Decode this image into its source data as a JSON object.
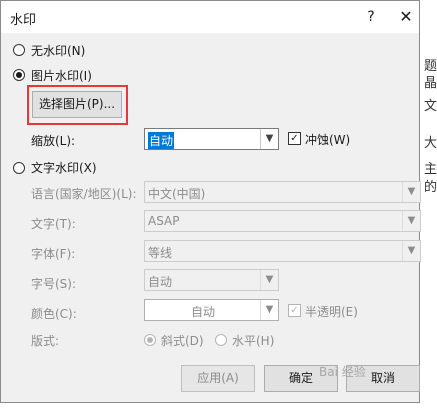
{
  "dialog": {
    "title": "水印",
    "help": "?",
    "close": "✕"
  },
  "options": {
    "none_label": "无水印(N)",
    "picture_label": "图片水印(I)",
    "select_picture": "选择图片(P)...",
    "scale_label": "缩放(L):",
    "scale_value": "自动",
    "washout_label": "冲蚀(W)",
    "text_label": "文字水印(X)"
  },
  "text_watermark": {
    "language_label": "语言(国家/地区)(L):",
    "language_value": "中文(中国)",
    "text_label": "文字(T):",
    "text_value": "ASAP",
    "font_label": "字体(F):",
    "font_value": "等线",
    "size_label": "字号(S):",
    "size_value": "自动",
    "color_label": "颜色(C):",
    "color_value": "自动",
    "semitransparent_label": "半透明(E)",
    "layout_label": "版式:",
    "diagonal_label": "斜式(D)",
    "horizontal_label": "水平(H)"
  },
  "buttons": {
    "apply": "应用(A)",
    "ok": "确定",
    "cancel": "取消"
  },
  "watermark_text": "Bai 经验",
  "doc_chars": [
    "题",
    "晶",
    "文",
    "大",
    "主",
    "的"
  ]
}
